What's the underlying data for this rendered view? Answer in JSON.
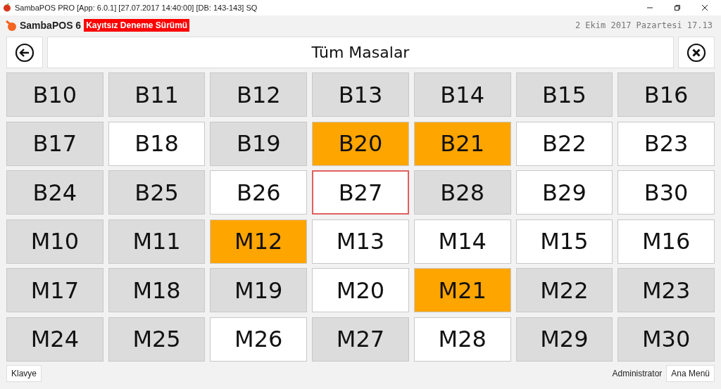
{
  "window": {
    "title": "SambaPOS PRO [App: 6.0.1] [27.07.2017 14:40:00] [DB: 143-143] SQ"
  },
  "header": {
    "brand": "SambaPOS 6",
    "badge": "Kayıtsız Deneme Sürümü",
    "datetime": "2 Ekim 2017 Pazartesi 17.13"
  },
  "nav": {
    "title": "Tüm Masalar"
  },
  "tables": [
    {
      "name": "B10",
      "color": "#dcdcdc",
      "focused": false
    },
    {
      "name": "B11",
      "color": "#dcdcdc",
      "focused": false
    },
    {
      "name": "B12",
      "color": "#dcdcdc",
      "focused": false
    },
    {
      "name": "B13",
      "color": "#dcdcdc",
      "focused": false
    },
    {
      "name": "B14",
      "color": "#dcdcdc",
      "focused": false
    },
    {
      "name": "B15",
      "color": "#dcdcdc",
      "focused": false
    },
    {
      "name": "B16",
      "color": "#dcdcdc",
      "focused": false
    },
    {
      "name": "B17",
      "color": "#dcdcdc",
      "focused": false
    },
    {
      "name": "B18",
      "color": "#ffffff",
      "focused": false
    },
    {
      "name": "B19",
      "color": "#dcdcdc",
      "focused": false
    },
    {
      "name": "B20",
      "color": "#ffa500",
      "focused": false
    },
    {
      "name": "B21",
      "color": "#ffa500",
      "focused": false
    },
    {
      "name": "B22",
      "color": "#ffffff",
      "focused": false
    },
    {
      "name": "B23",
      "color": "#ffffff",
      "focused": false
    },
    {
      "name": "B24",
      "color": "#dcdcdc",
      "focused": false
    },
    {
      "name": "B25",
      "color": "#dcdcdc",
      "focused": false
    },
    {
      "name": "B26",
      "color": "#ffffff",
      "focused": false
    },
    {
      "name": "B27",
      "color": "#ffffff",
      "focused": true
    },
    {
      "name": "B28",
      "color": "#dcdcdc",
      "focused": false
    },
    {
      "name": "B29",
      "color": "#ffffff",
      "focused": false
    },
    {
      "name": "B30",
      "color": "#ffffff",
      "focused": false
    },
    {
      "name": "M10",
      "color": "#dcdcdc",
      "focused": false
    },
    {
      "name": "M11",
      "color": "#dcdcdc",
      "focused": false
    },
    {
      "name": "M12",
      "color": "#ffa500",
      "focused": false
    },
    {
      "name": "M13",
      "color": "#ffffff",
      "focused": false
    },
    {
      "name": "M14",
      "color": "#ffffff",
      "focused": false
    },
    {
      "name": "M15",
      "color": "#ffffff",
      "focused": false
    },
    {
      "name": "M16",
      "color": "#ffffff",
      "focused": false
    },
    {
      "name": "M17",
      "color": "#dcdcdc",
      "focused": false
    },
    {
      "name": "M18",
      "color": "#dcdcdc",
      "focused": false
    },
    {
      "name": "M19",
      "color": "#dcdcdc",
      "focused": false
    },
    {
      "name": "M20",
      "color": "#ffffff",
      "focused": false
    },
    {
      "name": "M21",
      "color": "#ffa500",
      "focused": false
    },
    {
      "name": "M22",
      "color": "#dcdcdc",
      "focused": false
    },
    {
      "name": "M23",
      "color": "#dcdcdc",
      "focused": false
    },
    {
      "name": "M24",
      "color": "#dcdcdc",
      "focused": false
    },
    {
      "name": "M25",
      "color": "#dcdcdc",
      "focused": false
    },
    {
      "name": "M26",
      "color": "#ffffff",
      "focused": false
    },
    {
      "name": "M27",
      "color": "#dcdcdc",
      "focused": false
    },
    {
      "name": "M28",
      "color": "#ffffff",
      "focused": false
    },
    {
      "name": "M29",
      "color": "#dcdcdc",
      "focused": false
    },
    {
      "name": "M30",
      "color": "#dcdcdc",
      "focused": false
    }
  ],
  "footer": {
    "keyboard_button": "Klavye",
    "user": "Administrator",
    "menu_button": "Ana Menü"
  }
}
